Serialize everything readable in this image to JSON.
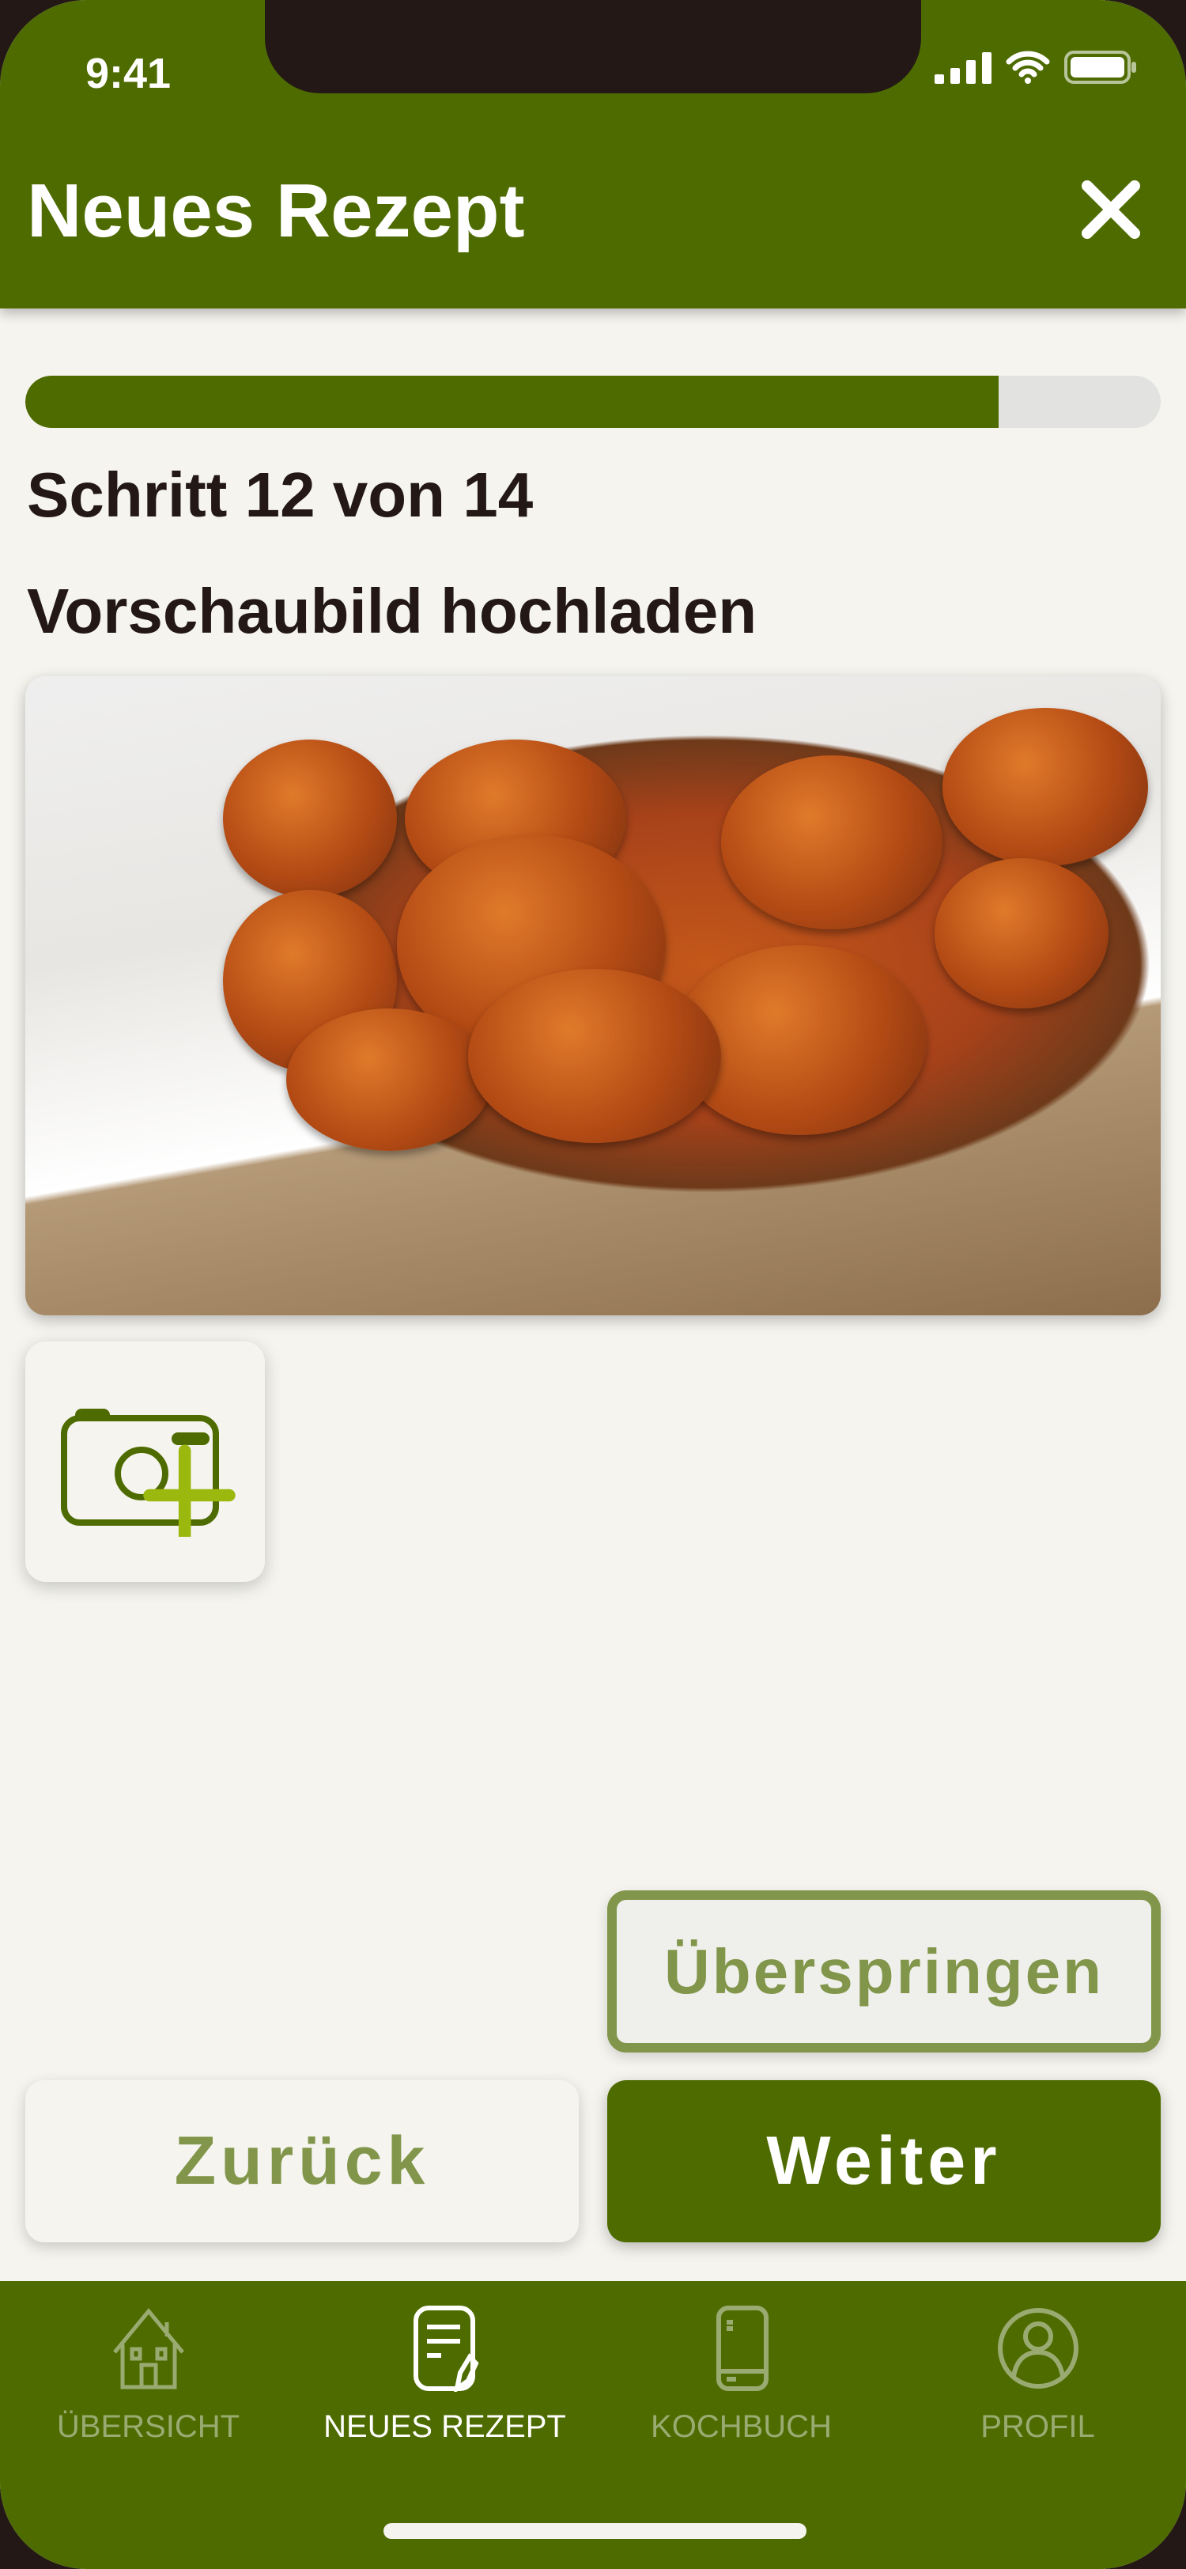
{
  "status_bar": {
    "time": "9:41"
  },
  "header": {
    "title": "Neues Rezept"
  },
  "progress": {
    "current": 12,
    "total": 14,
    "fraction": 0.857
  },
  "step_label": "Schritt 12 von 14",
  "step_title": "Vorschaubild hochladen",
  "buttons": {
    "skip": "Überspringen",
    "back": "Zurück",
    "next": "Weiter"
  },
  "nav": [
    {
      "label": "ÜBERSICHT",
      "icon": "house-icon"
    },
    {
      "label": "NEUES REZEPT",
      "icon": "recipe-edit-icon",
      "active": true
    },
    {
      "label": "KOCHBUCH",
      "icon": "book-icon"
    },
    {
      "label": "PROFIL",
      "icon": "user-icon"
    }
  ],
  "colors": {
    "primary": "#4e6b00",
    "accent": "#9bb80e",
    "muted": "#81964a",
    "background": "#f5f4ef"
  }
}
